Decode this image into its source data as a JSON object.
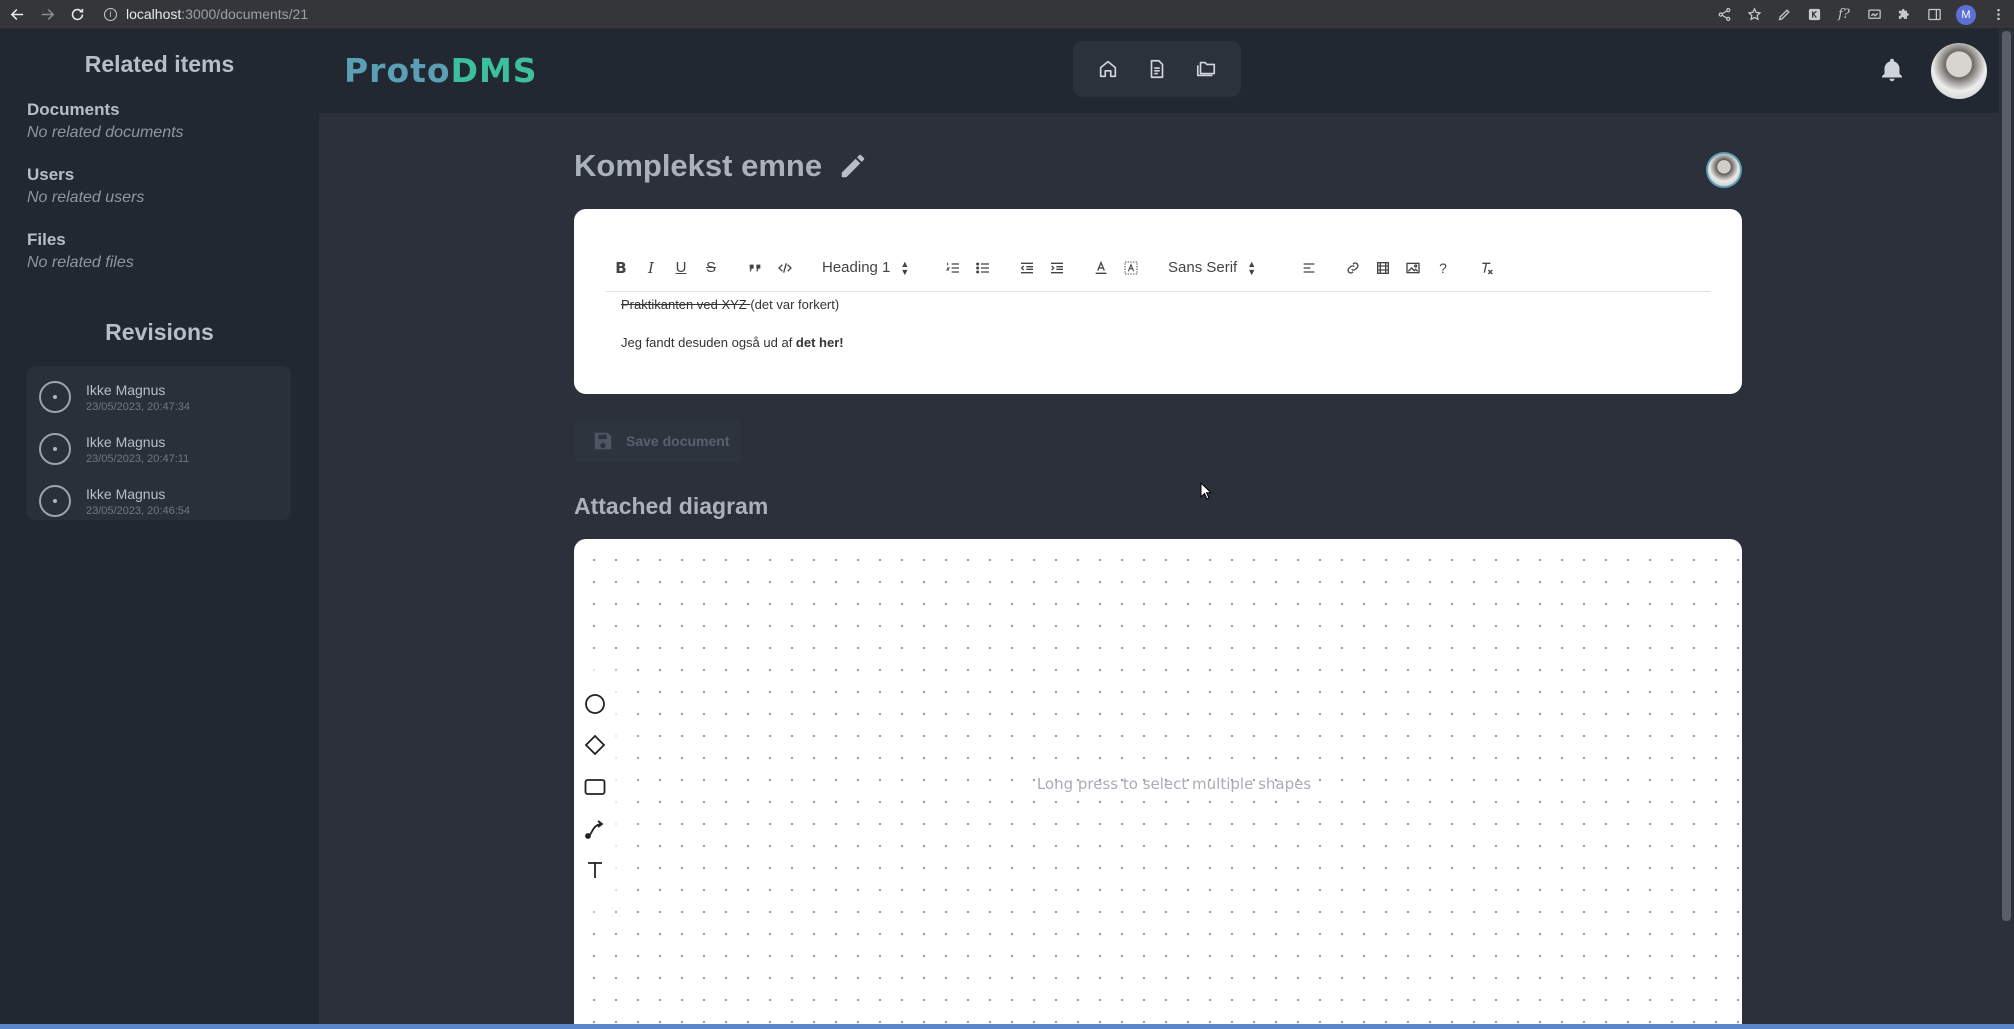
{
  "browser": {
    "url_host": "localhost",
    "url_path": ":3000/documents/21",
    "profile_initial": "M"
  },
  "sidebar": {
    "related_title": "Related items",
    "groups": [
      {
        "title": "Documents",
        "empty": "No related documents"
      },
      {
        "title": "Users",
        "empty": "No related users"
      },
      {
        "title": "Files",
        "empty": "No related files"
      }
    ],
    "revisions_title": "Revisions",
    "revisions": [
      {
        "name": "Ikke Magnus",
        "date": "23/05/2023, 20:47:34"
      },
      {
        "name": "Ikke Magnus",
        "date": "23/05/2023, 20:47:11"
      },
      {
        "name": "Ikke Magnus",
        "date": "23/05/2023, 20:46:54"
      }
    ]
  },
  "header": {
    "logo_part1": "Proto",
    "logo_part2": "DMS",
    "nav_icons": [
      "home-icon",
      "document-icon",
      "folders-icon"
    ],
    "logo_colors": {
      "proto": "#5a9fb3",
      "dms": "#3ebf9c"
    }
  },
  "document": {
    "title": "Komplekst emne",
    "toolbar": {
      "heading_select": "Heading 1",
      "font_select": "Sans Serif",
      "help_label": "?"
    },
    "content": {
      "line1_strike": "Praktikanten ved XYZ ",
      "line1_rest": "(det var forkert)",
      "line2_prefix": "Jeg fandt desuden også ud af ",
      "line2_bold": "det her!"
    },
    "save_label": "Save document"
  },
  "diagram": {
    "title": "Attached diagram",
    "hint": "Long press to select multiple shapes",
    "tools": [
      "circle-tool-icon",
      "diamond-tool-icon",
      "rectangle-tool-icon",
      "connector-tool-icon",
      "text-tool-icon"
    ]
  }
}
